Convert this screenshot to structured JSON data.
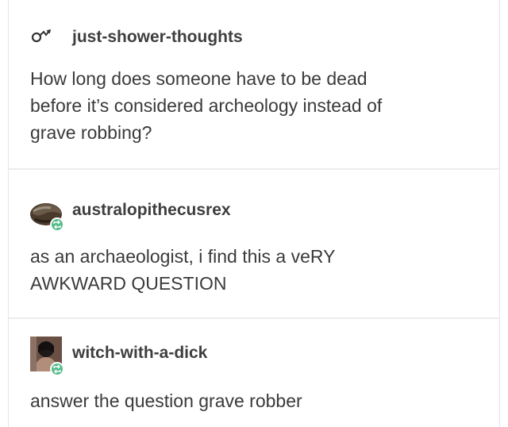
{
  "posts": [
    {
      "username": "just-shower-thoughts",
      "body": [
        "How long does someone have to be dead",
        "before it’s considered archeology instead of",
        "grave robbing?"
      ],
      "icon": "reblog-trail-icon"
    },
    {
      "username": "australopithecusrex",
      "body": [
        "as an archaeologist, i find this a veRY",
        "AWKWARD QUESTION"
      ],
      "avatar": "user-avatar",
      "badge": "reblog-badge-icon"
    },
    {
      "username": "witch-with-a-dick",
      "body": [
        "answer the question grave robber"
      ],
      "avatar": "user-avatar",
      "badge": "reblog-badge-icon"
    }
  ],
  "colors": {
    "text": "#3a3a3a",
    "divider": "#ececec",
    "badge": "#56bc8a"
  }
}
